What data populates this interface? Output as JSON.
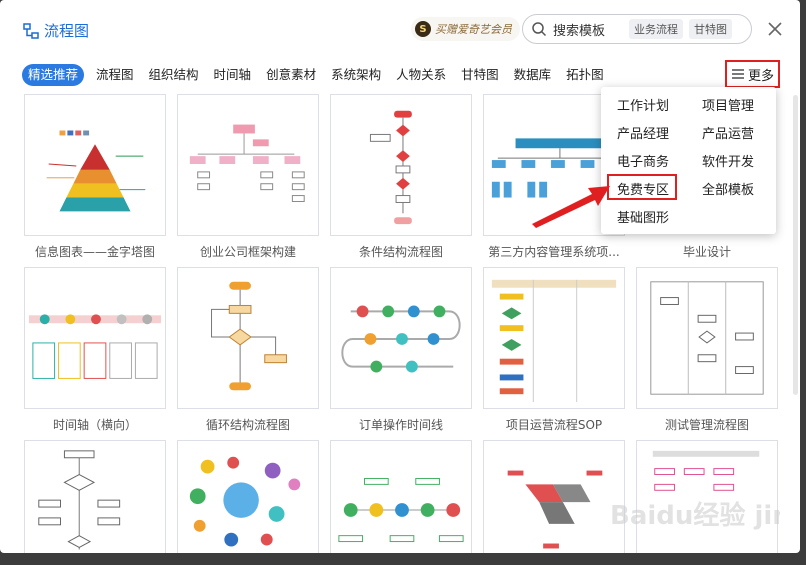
{
  "header": {
    "app_title": "流程图",
    "promo_badge": "S",
    "promo_text": "买赠爱奇艺会员",
    "search_placeholder": "搜索模板",
    "search_chips": [
      "业务流程",
      "甘特图"
    ]
  },
  "tabs": [
    "精选推荐",
    "流程图",
    "组织结构",
    "时间轴",
    "创意素材",
    "系统架构",
    "人物关系",
    "甘特图",
    "数据库",
    "拓扑图"
  ],
  "more_label": "更多",
  "dropdown": {
    "items": [
      "工作计划",
      "项目管理",
      "产品经理",
      "产品运营",
      "电子商务",
      "软件开发",
      "免费专区",
      "全部模板",
      "基础图形"
    ],
    "highlighted": "免费专区"
  },
  "templates": [
    {
      "title": "信息图表——金字塔图"
    },
    {
      "title": "创业公司框架构建"
    },
    {
      "title": "条件结构流程图"
    },
    {
      "title": "第三方内容管理系统项..."
    },
    {
      "title": "毕业设计"
    },
    {
      "title": "时间轴（横向）"
    },
    {
      "title": "循环结构流程图"
    },
    {
      "title": "订单操作时间线"
    },
    {
      "title": "项目运营流程SOP"
    },
    {
      "title": "测试管理流程图"
    },
    {
      "title": ""
    },
    {
      "title": ""
    },
    {
      "title": ""
    },
    {
      "title": ""
    },
    {
      "title": ""
    }
  ],
  "watermark": "Baidu经验 jingyan.baidu.com",
  "colors": {
    "accent": "#2a7ae2",
    "highlight_red": "#e02020"
  }
}
